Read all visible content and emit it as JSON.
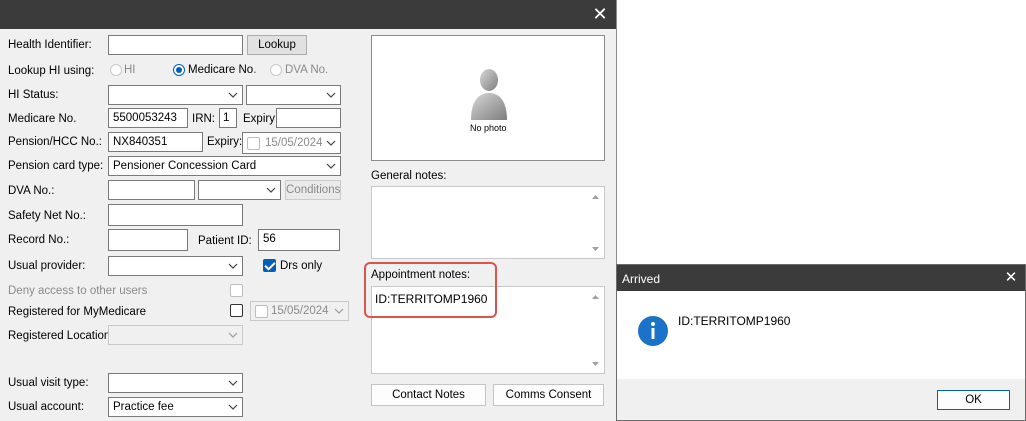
{
  "form": {
    "health_identifier_label": "Health Identifier:",
    "health_identifier_value": "",
    "lookup_button": "Lookup",
    "lookup_hi_label": "Lookup HI using:",
    "lookup_options": [
      "HI",
      "Medicare No.",
      "DVA No."
    ],
    "lookup_selected": "Medicare No.",
    "hi_status_label": "HI Status:",
    "hi_status_value": "",
    "medicare_label": "Medicare No.",
    "medicare_value": "5500053243",
    "irn_label": "IRN:",
    "irn_value": "1",
    "expiry_label": "Expiry:",
    "medicare_expiry_value": "",
    "pension_label": "Pension/HCC No.:",
    "pension_value": "NX840351",
    "pension_expiry_label": "Expiry:",
    "pension_expiry_value": "15/05/2024",
    "pension_card_type_label": "Pension card type:",
    "pension_card_type_value": "Pensioner Concession Card",
    "dva_label": "DVA No.:",
    "dva_value": "",
    "dva_type_value": "",
    "conditions_button": "Conditions",
    "safety_net_label": "Safety Net No.:",
    "safety_net_value": "",
    "record_label": "Record No.:",
    "record_value": "",
    "patient_id_label": "Patient ID:",
    "patient_id_value": "56",
    "usual_provider_label": "Usual provider:",
    "usual_provider_value": "",
    "drs_only_label": "Drs only",
    "deny_access_label": "Deny access to other users",
    "registered_mymedicare_label": "Registered for MyMedicare",
    "registered_date_value": "15/05/2024",
    "registered_location_label": "Registered Location:",
    "registered_location_value": "",
    "usual_visit_type_label": "Usual visit type:",
    "usual_visit_type_value": "",
    "usual_account_label": "Usual account:",
    "usual_account_value": "Practice fee"
  },
  "photo": {
    "caption": "No photo"
  },
  "notes": {
    "general_label": "General notes:",
    "general_value": "",
    "appointment_label": "Appointment notes:",
    "appointment_value": "ID:TERRITOMP1960"
  },
  "buttons": {
    "contact_notes": "Contact Notes",
    "comms_consent": "Comms Consent"
  },
  "dialog": {
    "title": "Arrived",
    "message": "ID:TERRITOMP1960",
    "ok": "OK"
  },
  "colors": {
    "titlebar": "#3b3b3b",
    "accent": "#005fb8",
    "highlight_border": "#d9534f",
    "info_icon": "#1a73c9"
  },
  "icons": {
    "close": "close-icon",
    "photo": "person-silhouette-icon",
    "dialog_info": "info-icon",
    "dropdown": "chevron-down-icon"
  }
}
